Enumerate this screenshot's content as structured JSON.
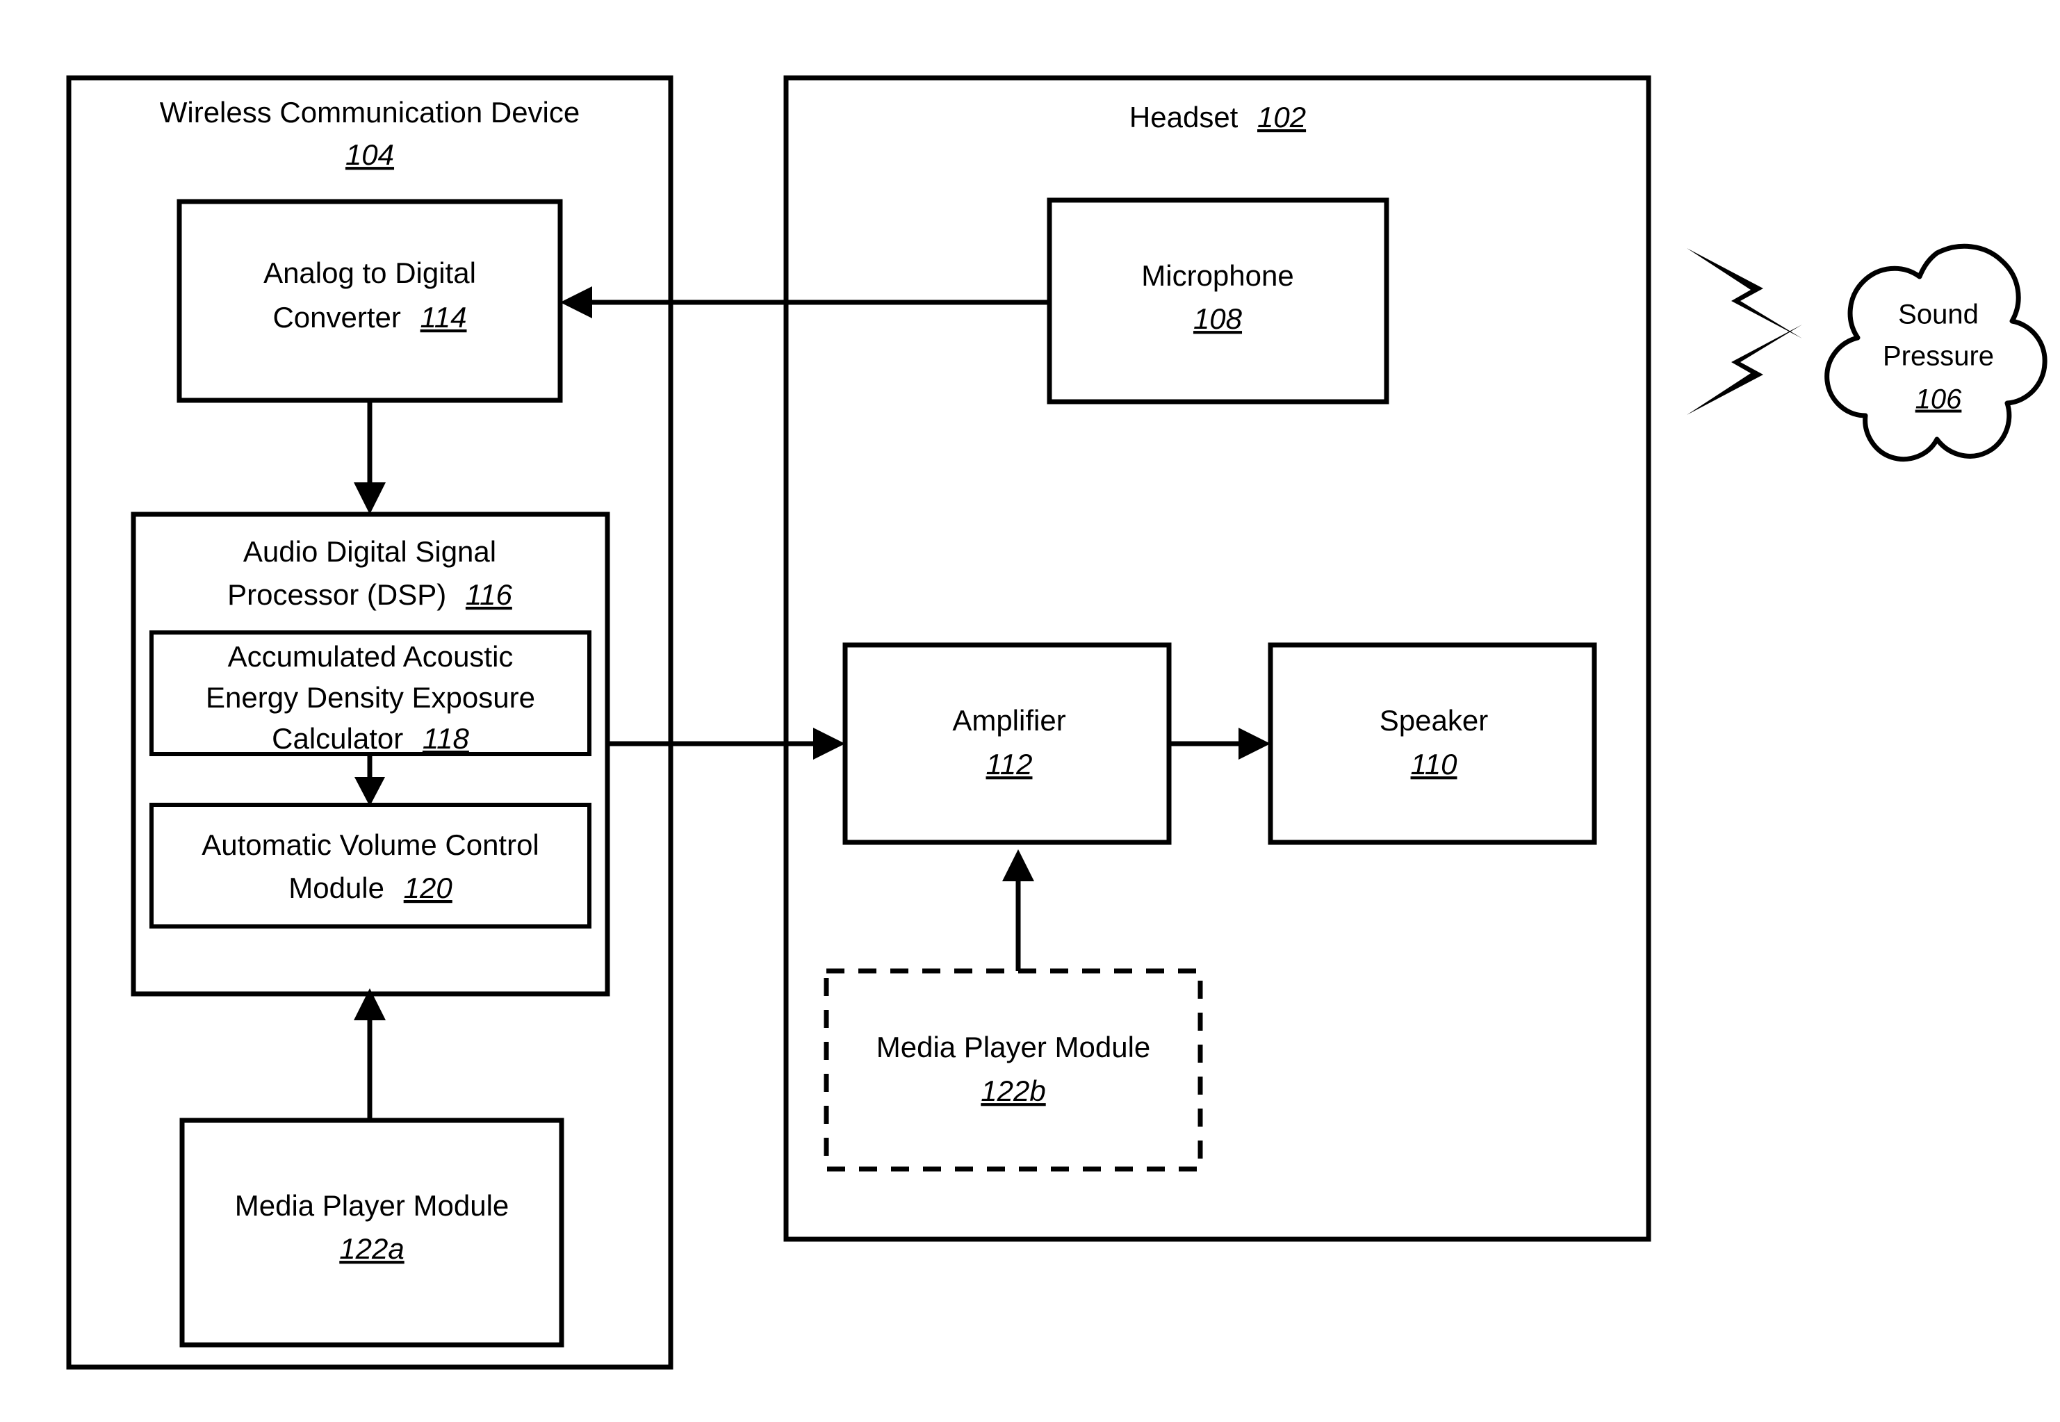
{
  "figure": {
    "type": "patent-block-diagram",
    "background": "#ffffff",
    "line_color": "#000000"
  },
  "containers": {
    "wireless_device": {
      "title_line1": "Wireless Communication Device",
      "ref": "104"
    },
    "headset": {
      "title": "Headset",
      "ref": "102"
    }
  },
  "blocks": {
    "adc": {
      "line1": "Analog to Digital",
      "line2": "Converter",
      "ref": "114"
    },
    "dsp": {
      "line1": "Audio Digital Signal",
      "line2": "Processor (DSP)",
      "ref": "116"
    },
    "calculator": {
      "line1": "Accumulated Acoustic",
      "line2": "Energy Density Exposure",
      "line3": "Calculator",
      "ref": "118"
    },
    "avc": {
      "line1": "Automatic Volume Control",
      "line2": "Module",
      "ref": "120"
    },
    "media_player_a": {
      "line1": "Media Player Module",
      "ref": "122a"
    },
    "microphone": {
      "line1": "Microphone",
      "ref": "108"
    },
    "amplifier": {
      "line1": "Amplifier",
      "ref": "112"
    },
    "speaker": {
      "line1": "Speaker",
      "ref": "110"
    },
    "media_player_b": {
      "line1": "Media Player Module",
      "ref": "122b",
      "style": "dashed"
    },
    "sound_pressure": {
      "line1": "Sound",
      "line2": "Pressure",
      "ref": "106"
    }
  },
  "connections": [
    {
      "name": "microphone-to-adc",
      "from": "microphone",
      "to": "adc",
      "direction": "left"
    },
    {
      "name": "adc-to-dsp",
      "from": "adc",
      "to": "dsp",
      "direction": "down"
    },
    {
      "name": "calculator-to-avc",
      "from": "calculator",
      "to": "avc",
      "direction": "down"
    },
    {
      "name": "dsp-to-amplifier",
      "from": "dsp",
      "to": "amplifier",
      "direction": "right"
    },
    {
      "name": "amplifier-to-speaker",
      "from": "amplifier",
      "to": "speaker",
      "direction": "right"
    },
    {
      "name": "media-player-b-to-amplifier",
      "from": "media_player_b",
      "to": "amplifier",
      "direction": "up"
    },
    {
      "name": "media-player-a-to-dsp",
      "from": "media_player_a",
      "to": "dsp",
      "direction": "up"
    }
  ],
  "decorations": {
    "sound_wave_bolts": 2
  }
}
